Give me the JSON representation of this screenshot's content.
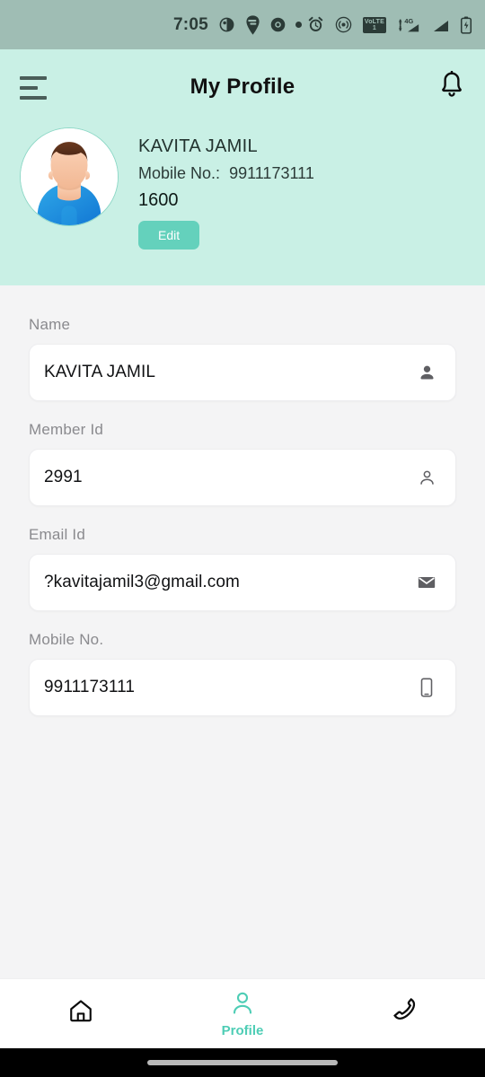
{
  "status_bar": {
    "time": "7:05",
    "left_icons": [
      "contrast-circle-icon",
      "swiggy-pin-icon",
      "chrome-icon",
      "dot-icon"
    ],
    "right_icons": [
      "alarm-clock-icon",
      "hotspot-icon",
      "volte-icon",
      "signal-4g-icon",
      "signal-icon",
      "battery-icon"
    ],
    "volte_top": "VoLTE",
    "volte_sim": "1",
    "network": "4G+",
    "bg_color": "#9FBDB4"
  },
  "header": {
    "title": "My Profile",
    "menu_icon": "hamburger-menu-icon",
    "notification_icon": "bell-icon",
    "bg_color": "#C9F0E5"
  },
  "profile": {
    "avatar_alt": "user-avatar",
    "name": "KAVITA JAMIL",
    "mobile_label": "Mobile No.:",
    "mobile_value": "9911173111",
    "points": "1600",
    "edit_label": "Edit",
    "edit_color": "#64D1BC"
  },
  "form": {
    "fields": [
      {
        "label": "Name",
        "value": "KAVITA JAMIL",
        "icon": "person-filled-icon"
      },
      {
        "label": "Member Id",
        "value": "2991",
        "icon": "person-outline-icon"
      },
      {
        "label": "Email Id",
        "value": "?kavitajamil3@gmail.com",
        "icon": "envelope-icon"
      },
      {
        "label": "Mobile No.",
        "value": "9911173111",
        "icon": "smartphone-icon"
      }
    ]
  },
  "bottom_nav": {
    "items": [
      {
        "label": "",
        "icon": "home-icon",
        "active": false
      },
      {
        "label": "Profile",
        "icon": "person-icon",
        "active": true
      },
      {
        "label": "",
        "icon": "phone-call-icon",
        "active": false
      }
    ],
    "active_color": "#4ECDB5"
  }
}
